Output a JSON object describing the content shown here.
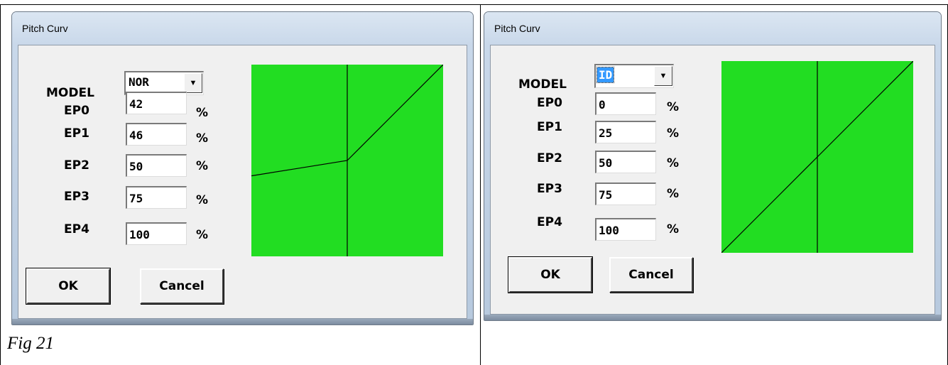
{
  "caption": "Fig 21",
  "graph_color": "#22dd22",
  "dialogs": [
    {
      "title": "Pitch Curv",
      "model_label": "MODEL",
      "model_value": "NOR",
      "model_value_selected": false,
      "ep_labels": [
        "EP0",
        "EP1",
        "EP2",
        "EP3",
        "EP4"
      ],
      "ep_values": [
        "42",
        "46",
        "50",
        "75",
        "100"
      ],
      "unit": "%",
      "ok_label": "OK",
      "cancel_label": "Cancel",
      "curve_percent": [
        42,
        46,
        50,
        75,
        100
      ]
    },
    {
      "title": "Pitch Curv",
      "model_label": "MODEL",
      "model_value": "ID",
      "model_value_selected": true,
      "ep_labels": [
        "EP0",
        "EP1",
        "EP2",
        "EP3",
        "EP4"
      ],
      "ep_values": [
        "0",
        "25",
        "50",
        "75",
        "100"
      ],
      "unit": "%",
      "ok_label": "OK",
      "cancel_label": "Cancel",
      "curve_percent": [
        0,
        25,
        50,
        75,
        100
      ]
    }
  ]
}
